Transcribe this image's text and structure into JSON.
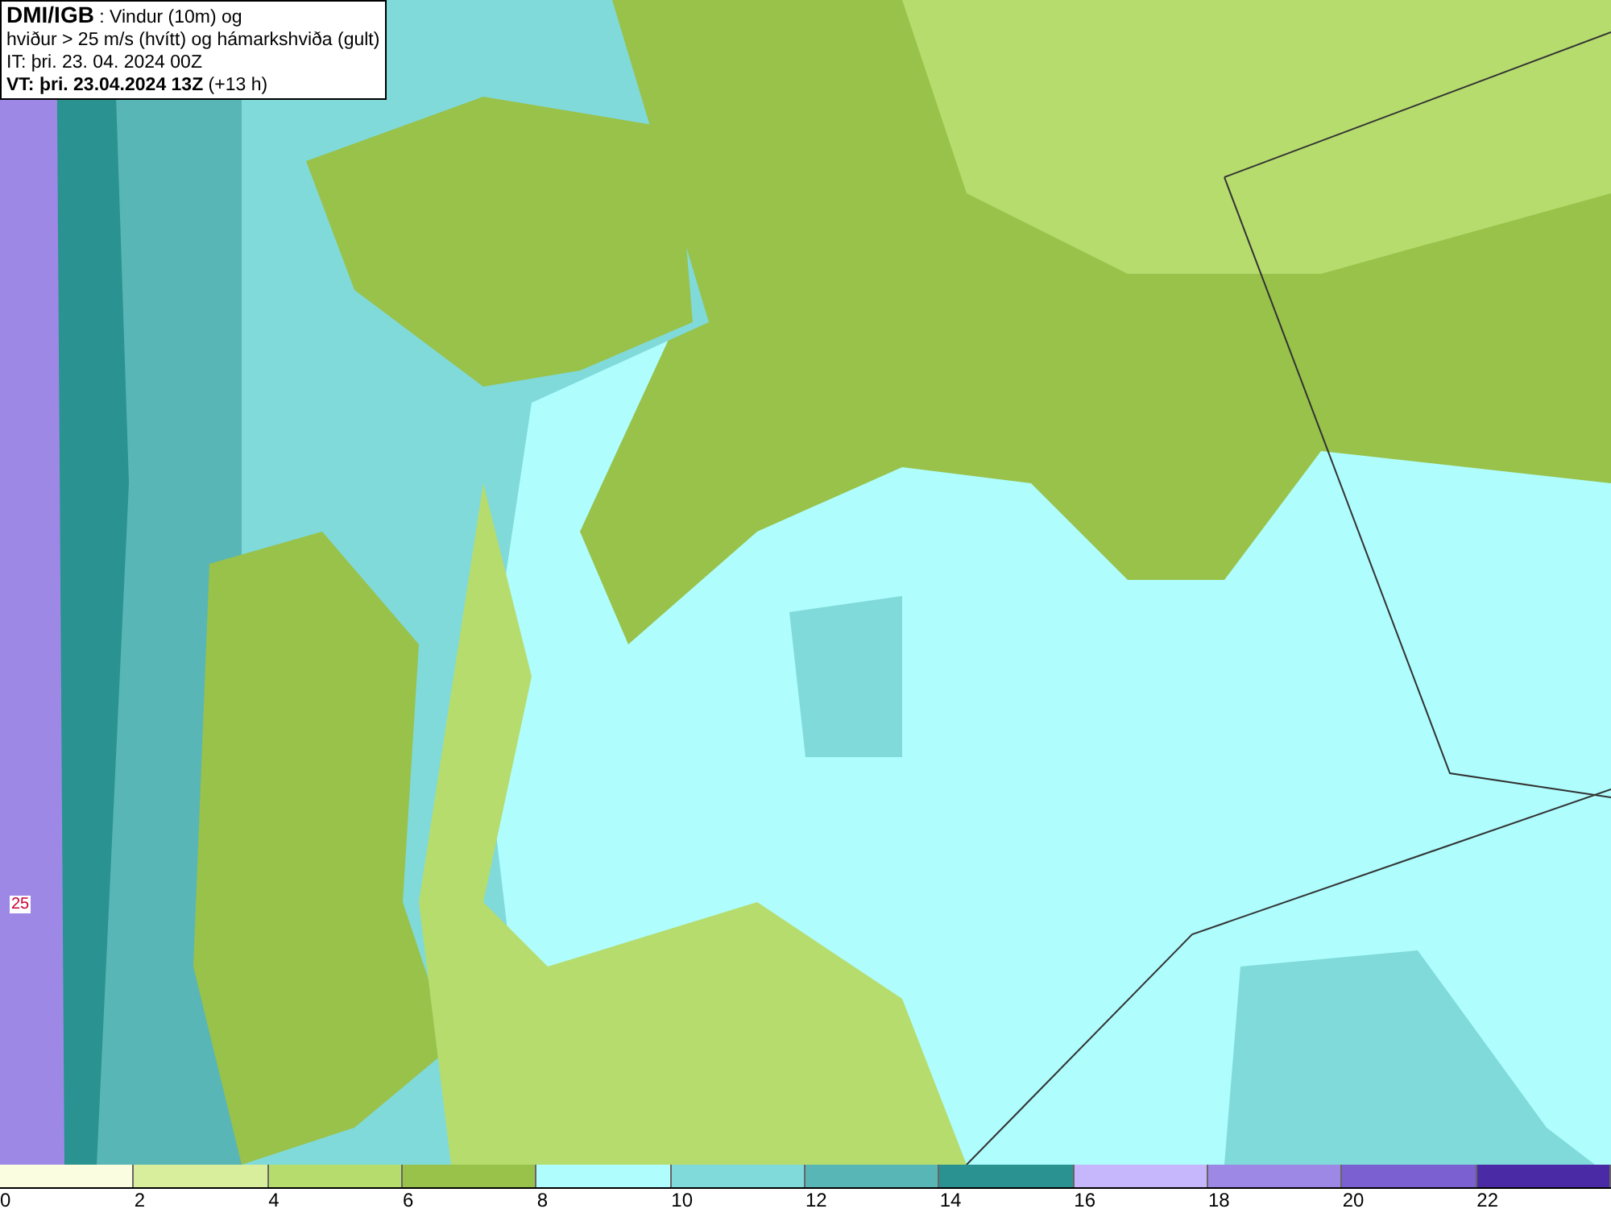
{
  "map": {
    "header_lines": [
      "**DMI/IGB** : Vindur (10m) og",
      "hviður > 25 m/s (hvítt) og hámarkshviða (gult)",
      "IT: þri. 23. 04. 2024 00Z",
      "**VT: þri. 23.04.2024 13Z** (+13 h)"
    ],
    "contour_labels": [
      "25"
    ]
  },
  "legend": [
    {
      "label": "0",
      "color": "#fafde0"
    },
    {
      "label": "2",
      "color": "#d8ee9c"
    },
    {
      "label": "4",
      "color": "#b6dc6e"
    },
    {
      "label": "6",
      "color": "#98c24a"
    },
    {
      "label": "8",
      "color": "#affdfd"
    },
    {
      "label": "10",
      "color": "#80dada"
    },
    {
      "label": "12",
      "color": "#58b6b6"
    },
    {
      "label": "14",
      "color": "#2a9290"
    },
    {
      "label": "16",
      "color": "#c6b6fc"
    },
    {
      "label": "18",
      "color": "#9e88e6"
    },
    {
      "label": "20",
      "color": "#7a60d0"
    },
    {
      "label": "22",
      "color": "#4b2aa6"
    }
  ]
}
